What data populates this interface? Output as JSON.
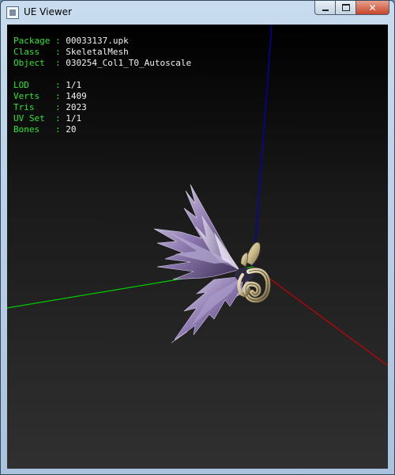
{
  "window": {
    "title": "UE Viewer"
  },
  "info": {
    "package_label": "Package : ",
    "package": "00033137.upk",
    "class_label": "Class   : ",
    "class": "SkeletalMesh",
    "object_label": "Object  : ",
    "object": "030254_Col1_T0_Autoscale",
    "lod_label": "LOD     : ",
    "lod": "1/1",
    "verts_label": "Verts   : ",
    "verts": "1409",
    "tris_label": "Tris    : ",
    "tris": "2023",
    "uvset_label": "UV Set  : ",
    "uvset": "1/1",
    "bones_label": "Bones   : ",
    "bones": "20"
  },
  "colors": {
    "label": "#2ee62e",
    "value": "#f2f2f2",
    "axis_x": "#cc0000",
    "axis_y": "#00cc00",
    "axis_z": "#0000cc"
  },
  "icons": {
    "app": "app-window-icon",
    "minimize": "minimize-icon",
    "maximize": "maximize-icon",
    "close": "close-icon"
  }
}
